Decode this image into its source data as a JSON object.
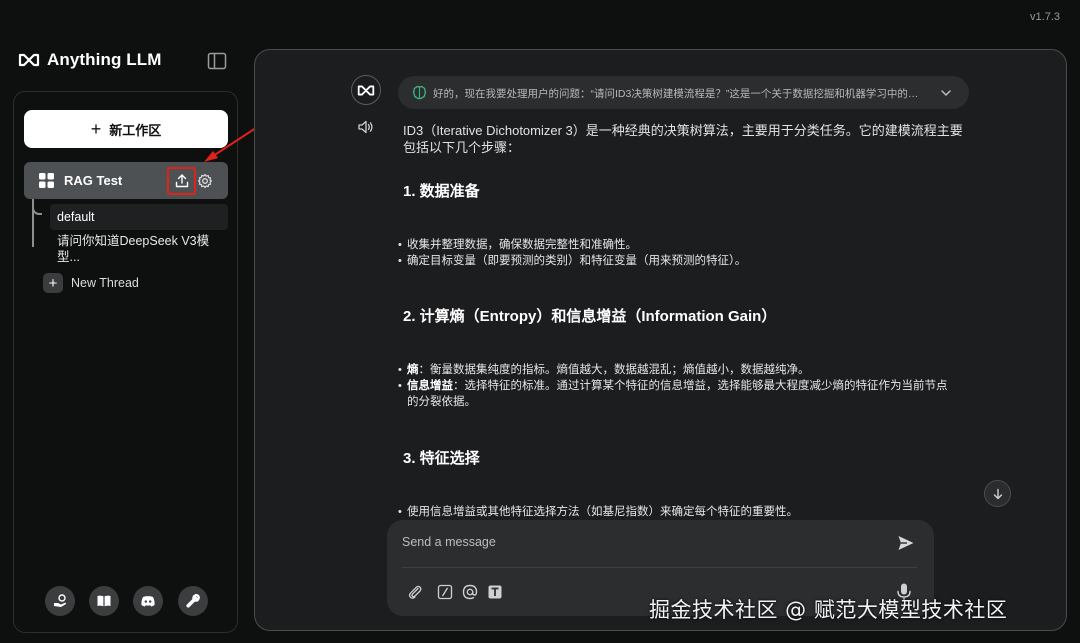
{
  "app": {
    "name": "Anything LLM",
    "version": "v1.7.3"
  },
  "sidebar": {
    "new_workspace_label": "新工作区",
    "workspace": {
      "name": "RAG Test"
    },
    "threads": [
      {
        "label": "default",
        "active": true
      },
      {
        "label": "请问你知道DeepSeek V3模型..."
      }
    ],
    "new_thread_label": "New Thread",
    "footer_icons": [
      "community-hub-icon",
      "docs-book-icon",
      "discord-icon",
      "settings-wrench-icon"
    ]
  },
  "chat": {
    "thinking_text": "好的，现在我要处理用户的问题：“请问ID3决策树建模流程是？”这是一个关于数据挖掘和机器学习中的决...",
    "intro": "ID3（Iterative Dichotomizer 3）是一种经典的决策树算法，主要用于分类任务。它的建模流程主要包括以下几个步骤：",
    "sections": [
      {
        "title": "1. 数据准备",
        "items": [
          {
            "bold": "",
            "text": "收集并整理数据，确保数据完整性和准确性。"
          },
          {
            "bold": "",
            "text": "确定目标变量（即要预测的类别）和特征变量（用来预测的特征）。"
          }
        ]
      },
      {
        "title": "2. 计算熵（Entropy）和信息增益（Information Gain）",
        "items": [
          {
            "bold": "熵",
            "text": "：衡量数据集纯度的指标。熵值越大，数据越混乱；熵值越小，数据越纯净。"
          },
          {
            "bold": "信息增益",
            "text": "：选择特征的标准。通过计算某个特征的信息增益，选择能够最大程度减少熵的特征作为当前节点的分裂依据。"
          }
        ]
      },
      {
        "title": "3. 特征选择",
        "items": [
          {
            "bold": "",
            "text": "使用信息增益或其他特征选择方法（如基尼指数）来确定每个特征的重要性。"
          }
        ]
      }
    ]
  },
  "composer": {
    "placeholder": "Send a message"
  },
  "watermark": "掘金技术社区 @ 赋范大模型技术社区",
  "colors": {
    "background": "#0e0f0f",
    "panel": "#1c1d1f",
    "highlight": "#e0221b"
  }
}
